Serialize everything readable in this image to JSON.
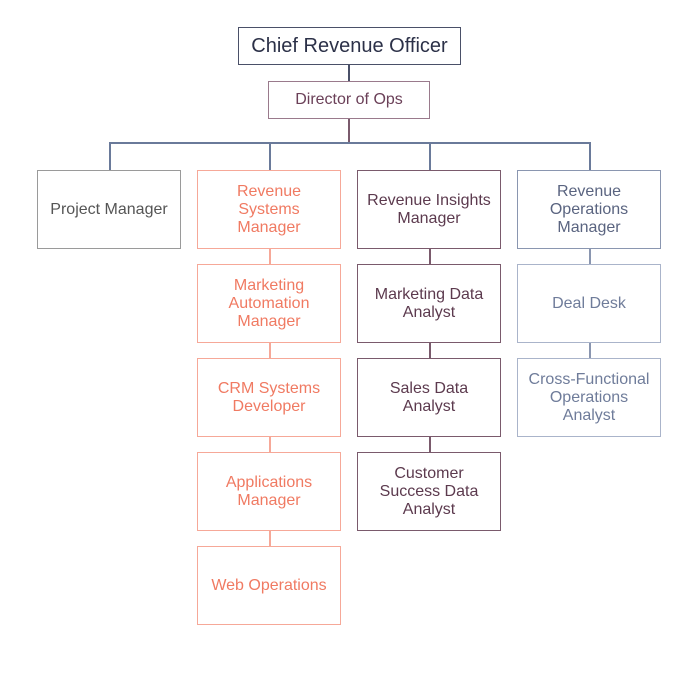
{
  "colors": {
    "executive": "#2c3148",
    "director": "#6b4058",
    "general": "#555555",
    "systems_team": "#f07a62",
    "insights_team": "#5c3a4e",
    "operations_team": "#5a6480",
    "connector_top": "#4a5068",
    "connector_branch": "#6a7a9a"
  },
  "org": {
    "root": {
      "title": "Chief Revenue Officer"
    },
    "director": {
      "title": "Director of Ops"
    },
    "branches": [
      {
        "title": "Project Manager",
        "reports": []
      },
      {
        "title": "Revenue Systems Manager",
        "reports": [
          {
            "title": "Marketing Automation Manager"
          },
          {
            "title": "CRM Systems Developer"
          },
          {
            "title": "Applications Manager"
          },
          {
            "title": "Web Operations"
          }
        ]
      },
      {
        "title": "Revenue Insights Manager",
        "reports": [
          {
            "title": "Marketing Data Analyst"
          },
          {
            "title": "Sales Data Analyst"
          },
          {
            "title": "Customer Success Data Analyst"
          }
        ]
      },
      {
        "title": "Revenue Operations Manager",
        "reports": [
          {
            "title": "Deal Desk"
          },
          {
            "title": "Cross-Functional Operations Analyst"
          }
        ]
      }
    ]
  }
}
